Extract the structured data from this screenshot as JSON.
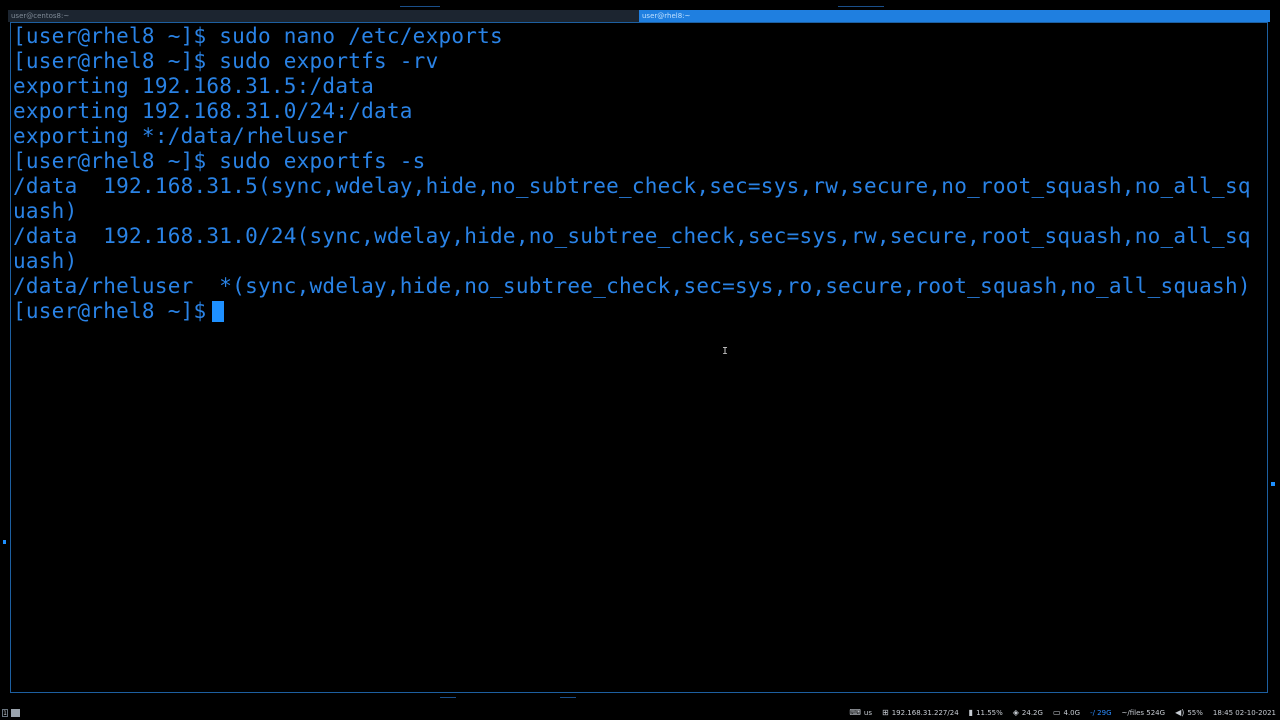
{
  "tabs": [
    {
      "title": "user@centos8:~",
      "active": false
    },
    {
      "title": "user@rhel8:~",
      "active": true
    }
  ],
  "terminal": {
    "lines": [
      "[user@rhel8 ~]$ sudo nano /etc/exports",
      "[user@rhel8 ~]$ sudo exportfs -rv",
      "exporting 192.168.31.5:/data",
      "exporting 192.168.31.0/24:/data",
      "exporting *:/data/rheluser",
      "[user@rhel8 ~]$ sudo exportfs -s",
      "/data  192.168.31.5(sync,wdelay,hide,no_subtree_check,sec=sys,rw,secure,no_root_squash,no_all_sq",
      "uash)",
      "/data  192.168.31.0/24(sync,wdelay,hide,no_subtree_check,sec=sys,rw,secure,root_squash,no_all_sq",
      "uash)",
      "/data/rheluser  *(sync,wdelay,hide,no_subtree_check,sec=sys,ro,secure,root_squash,no_all_squash)"
    ],
    "prompt": "[user@rhel8 ~]$"
  },
  "statusbar": {
    "workspace": "1",
    "keyboard": "us",
    "network": "192.168.31.227/24",
    "cpu": "11.55%",
    "temp": "24.2G",
    "disk1": "4.0G",
    "disk2": "-/ 29G",
    "disk3": "~/files 524G",
    "volume": "55%",
    "datetime": "18:45 02-10-2021"
  },
  "colors": {
    "terminal_text": "#2a83e6",
    "active_tab": "#1f7fe0",
    "cursor": "#1e90ff"
  },
  "icons": [
    "keyboard-icon",
    "network-icon",
    "cpu-icon",
    "temperature-icon",
    "disk-icon",
    "volume-icon",
    "clock-icon"
  ]
}
